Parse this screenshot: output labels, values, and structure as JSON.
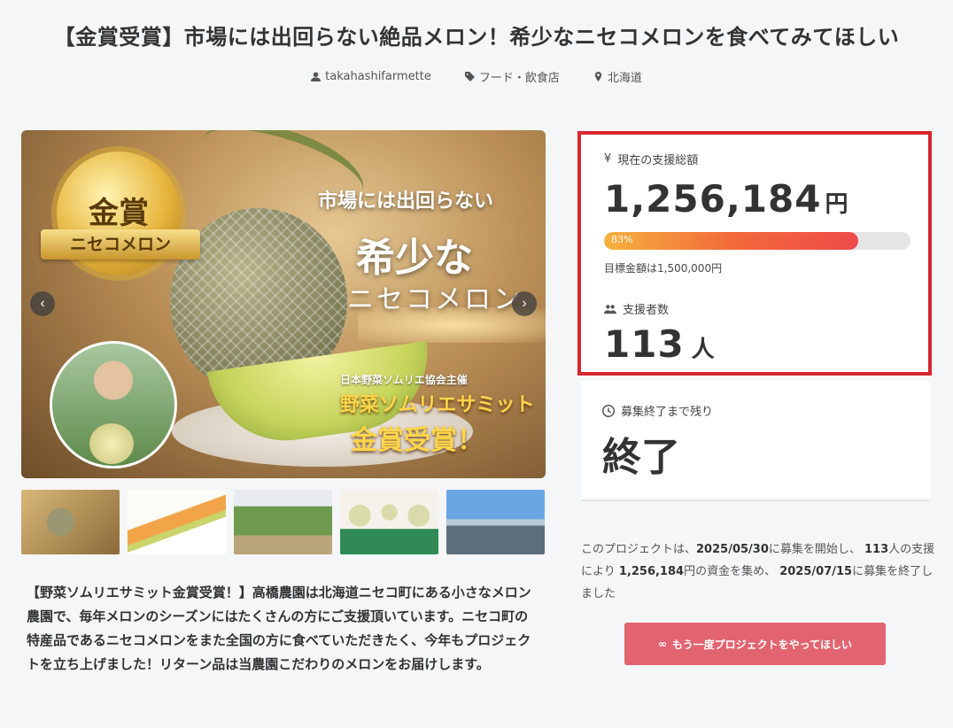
{
  "project": {
    "title": "【金賞受賞】市場には出回らない絶品メロン！希少なニセコメロンを食べてみてほしい",
    "owner": "takahashifarmette",
    "category": "フード・飲食店",
    "location": "北海道"
  },
  "hero": {
    "medal_text": "金賞",
    "ribbon_text": "ニセコメロン",
    "copy_line1": "市場には出回らない",
    "copy_line2": "希少な",
    "copy_line3": "ニセコメロン",
    "copy_line4": "日本野菜ソムリエ協会主催",
    "copy_line5": "野菜ソムリエサミット",
    "copy_line6": "金賞受賞！",
    "prev_icon": "chevron-left-icon",
    "next_icon": "chevron-right-icon",
    "prev_glyph": "‹",
    "next_glyph": "›"
  },
  "thumbnails_count": 5,
  "description": "【野菜ソムリエサミット金賞受賞！】高橋農園は北海道ニセコ町にある小さなメロン農園で、毎年メロンのシーズンにはたくさんの方にご支援頂いています。ニセコ町の特産品であるニセコメロンをまた全国の方に食べていただきたく、今年もプロジェクトを立ち上げました！リターン品は当農園こだわりのメロンをお届けします。",
  "stats": {
    "raised_label": "現在の支援総額",
    "raised_amount": "1,256,184",
    "raised_unit": "円",
    "progress_percent": 83,
    "progress_label": "83%",
    "goal_text": "目標金額は1,500,000円",
    "backers_label": "支援者数",
    "backers_count": "113",
    "backers_unit": "人",
    "remaining_label": "募集終了まで残り",
    "remaining_value": "終了"
  },
  "summary": {
    "p1": "このプロジェクトは、",
    "start_date": "2025/05/30",
    "p2": "に募集を開始し、 ",
    "backers": "113",
    "p3": "人の支援により ",
    "amount": "1,256,184",
    "p4": "円の資金を集め、 ",
    "end_date": "2025/07/15",
    "p5": "に募集を終了しました"
  },
  "cta": {
    "label": "もう一度プロジェクトをやってほしい",
    "icon_glyph": "∞"
  },
  "colors": {
    "highlight_border": "#d8262f",
    "cta_bg": "#e26470",
    "progress_start": "#f6b23e",
    "progress_end": "#ee4a4a"
  }
}
